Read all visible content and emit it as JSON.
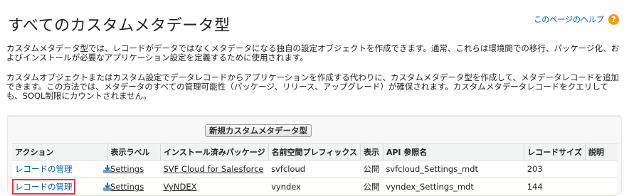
{
  "page": {
    "title": "すべてのカスタムメタデータ型",
    "help_link": "このページのヘルプ",
    "help_icon": "help-icon"
  },
  "paragraphs": [
    "カスタムメタデータ型では、レコードがデータではなくメタデータになる独自の設定オブジェクトを作成できます。通常、これらは環境間での移行、パッケージ化、およびインストールが必要なアプリケーション設定を定義するために使用されます。",
    "カスタムオブジェクトまたはカスタム設定でデータレコードからアプリケーションを作成する代わりに、カスタムメタデータ型を作成して、メタデータレコードを追加できます。この方法では、メタデータのすべての管理可能性（パッケージ、リリース、アップグレード）が確保されます。カスタムメタデータレコードをクエリしても、SOQL制限にカウントされません。"
  ],
  "toolbar": {
    "new_button": "新規カスタムメタデータ型"
  },
  "table": {
    "headers": {
      "action": "アクション",
      "label": "表示ラベル",
      "package": "インストール済みパッケージ",
      "namespace": "名前空間プレフィックス",
      "visibility": "表示",
      "api_name": "API 参照名",
      "record_size": "レコードサイズ",
      "description": "説明"
    },
    "rows": [
      {
        "action": "レコードの管理",
        "label": "Settings",
        "package": "SVF Cloud for Salesforce",
        "namespace": "svfcloud",
        "visibility": "公開",
        "api_name": "svfcloud_Settings_mdt",
        "record_size": "203",
        "description": ""
      },
      {
        "action": "レコードの管理",
        "label": "Settings",
        "package": "VyNDEX",
        "namespace": "vyndex",
        "visibility": "公開",
        "api_name": "vyndex_Settings_mdt",
        "record_size": "144",
        "description": ""
      }
    ]
  },
  "colors": {
    "link": "#015ba7",
    "highlight_box": "#e03a3a",
    "help_icon": "#f29c11"
  }
}
